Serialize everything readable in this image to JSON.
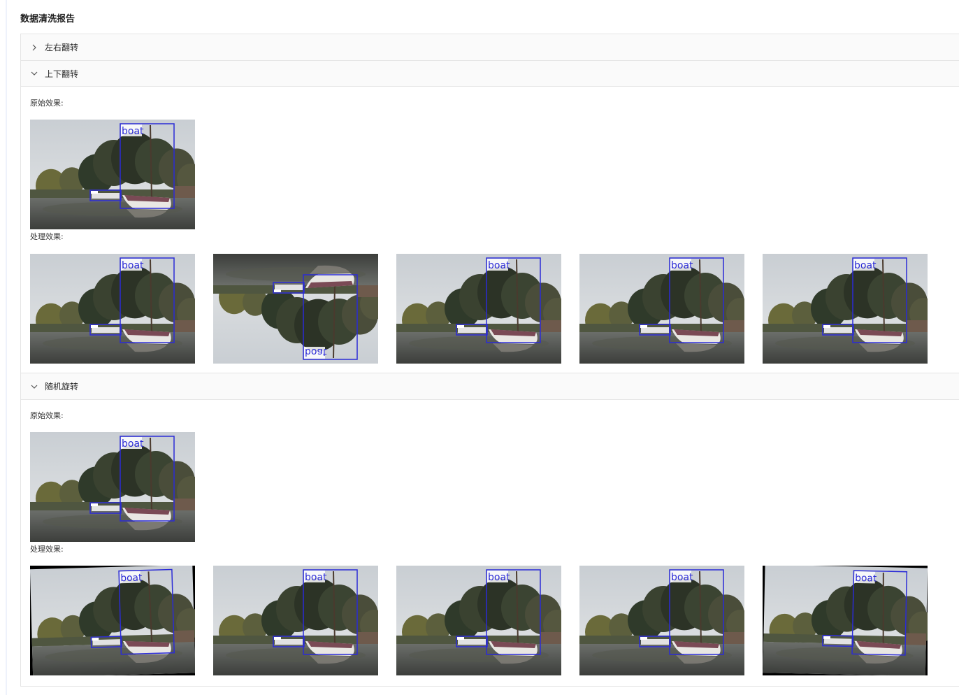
{
  "page": {
    "title": "数据清洗报告"
  },
  "panels": [
    {
      "label": "左右翻转",
      "expanded": false
    },
    {
      "label": "上下翻转",
      "expanded": true,
      "original_label": "原始效果:",
      "processed_label": "处理效果:"
    },
    {
      "label": "随机旋转",
      "expanded": true,
      "original_label": "原始效果:",
      "processed_label": "处理效果:"
    }
  ],
  "annotation": {
    "class_label": "boat",
    "box_color": "#2b2bd6"
  }
}
